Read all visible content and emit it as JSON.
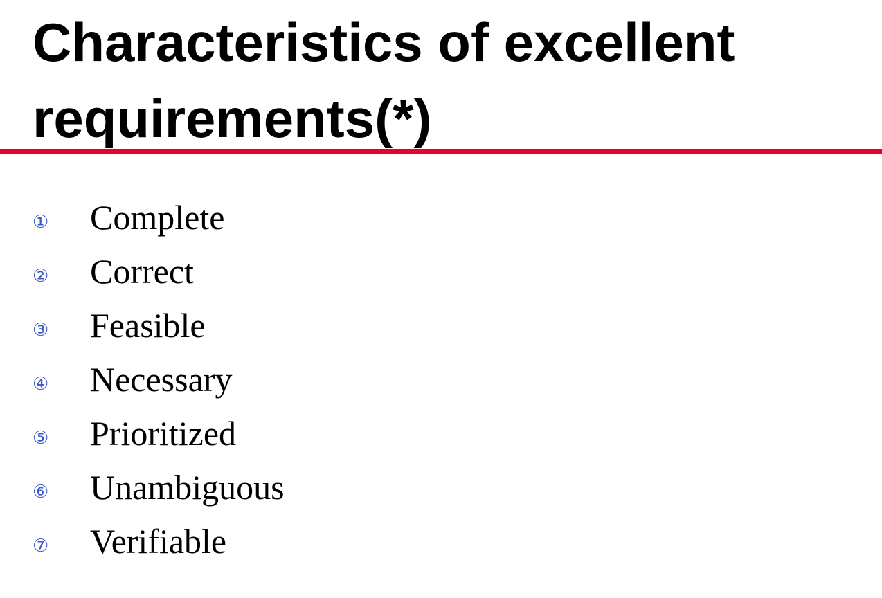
{
  "title": "Characteristics of excellent requirements(*)",
  "accent_color": "#e8002a",
  "bullet_color": "#3a58c8",
  "items": [
    {
      "marker": "①",
      "label": "Complete"
    },
    {
      "marker": "②",
      "label": "Correct"
    },
    {
      "marker": "③",
      "label": "Feasible"
    },
    {
      "marker": "④",
      "label": "Necessary"
    },
    {
      "marker": "⑤",
      "label": "Prioritized"
    },
    {
      "marker": "⑥",
      "label": "Unambiguous"
    },
    {
      "marker": "⑦",
      "label": "Verifiable"
    }
  ]
}
